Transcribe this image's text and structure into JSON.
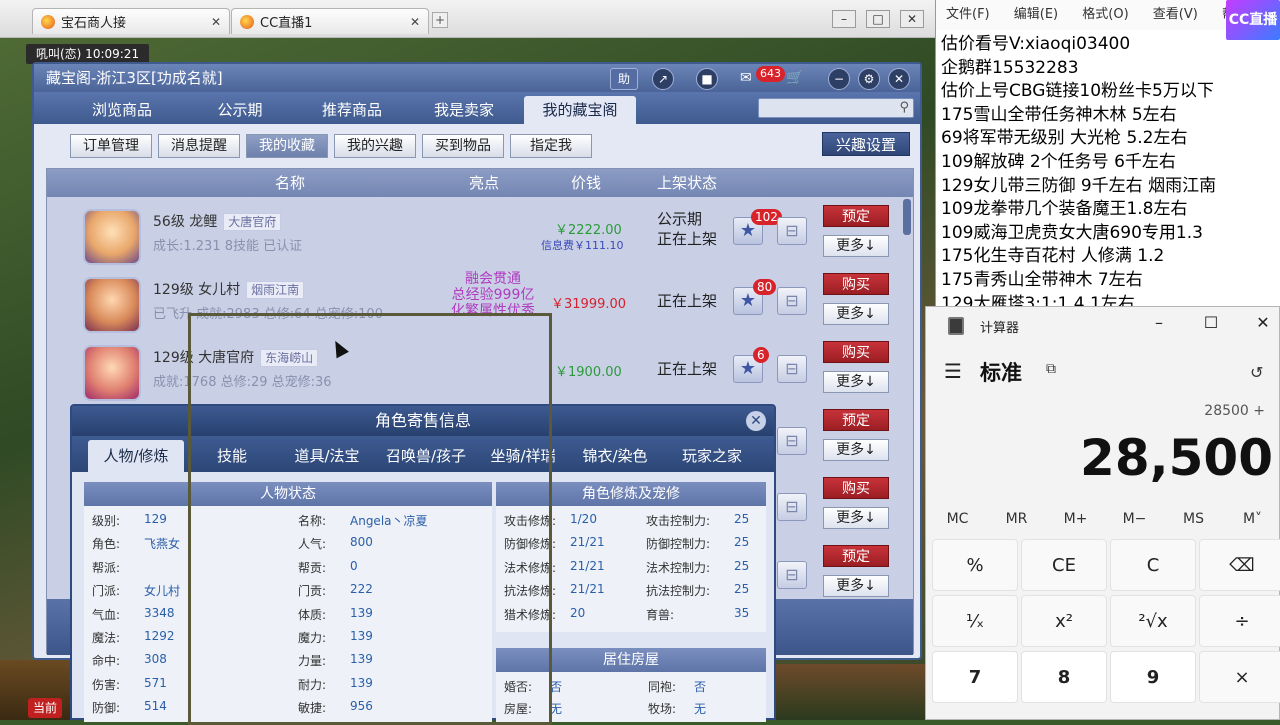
{
  "browser": {
    "tabs": [
      {
        "label": "宝石商人接",
        "close": "✕"
      },
      {
        "label": "CC直播1",
        "close": "✕"
      }
    ],
    "new_tab": "+",
    "clock": "吼叫(恋)  10:09:21"
  },
  "cbg": {
    "title": "藏宝阁-浙江3区[功成名就]",
    "title_icons": {
      "zhu": "助",
      "mail_count": "643"
    },
    "nav": [
      "浏览商品",
      "公示期",
      "推荐商品",
      "我是卖家",
      "我的藏宝阁"
    ],
    "nav_active": "我的藏宝阁",
    "subnav": [
      "订单管理",
      "消息提醒",
      "我的收藏",
      "我的兴趣",
      "买到物品",
      "指定我"
    ],
    "subnav_active": "我的收藏",
    "interest_btn": "兴趣设置",
    "table": {
      "headers": [
        "名称",
        "亮点",
        "价钱",
        "上架状态"
      ],
      "rows": [
        {
          "level_name": "56级 龙鲤",
          "tag": "大唐官府",
          "sub": "成长:1.231  8技能  已认证",
          "highlight": "",
          "price": "￥2222.00",
          "fee": "信息费￥111.10",
          "status": "公示期\n正在上架",
          "fav": "102",
          "action": "预定",
          "more": "更多↓"
        },
        {
          "level_name": "129级 女儿村",
          "tag": "烟雨江南",
          "sub": "已飞升  成就:2983  总修:64  总宠修:100",
          "highlight": "融会贯通\n总经验999亿\n化繁属性优秀",
          "price": "￥31999.00",
          "fee": "",
          "status": "正在上架",
          "fav": "80",
          "action": "购买",
          "more": "更多↓"
        },
        {
          "level_name": "129级 大唐官府",
          "tag": "东海崂山",
          "sub": "成就:1768  总修:29  总宠修:36",
          "highlight": "",
          "price": "￥1900.00",
          "fee": "",
          "status": "正在上架",
          "fav": "6",
          "action": "购买",
          "more": "更多↓"
        },
        {
          "action": "预定",
          "more": "更多↓"
        },
        {
          "action": "购买",
          "more": "更多↓"
        },
        {
          "action": "预定",
          "more": "更多↓"
        }
      ]
    }
  },
  "popup": {
    "title": "角色寄售信息",
    "tabs": [
      "人物/修炼",
      "技能",
      "道具/法宝",
      "召唤兽/孩子",
      "坐骑/祥瑞",
      "锦衣/染色",
      "玩家之家"
    ],
    "tab_active": "人物/修炼",
    "sec_status": "人物状态",
    "sec_cultivate": "角色修炼及宠修",
    "sec_house": "居住房屋",
    "status_left": [
      {
        "k": "级别:",
        "v": "129"
      },
      {
        "k": "角色:",
        "v": "飞燕女"
      },
      {
        "k": "帮派:",
        "v": ""
      },
      {
        "k": "门派:",
        "v": "女儿村"
      },
      {
        "k": "气血:",
        "v": "3348"
      },
      {
        "k": "魔法:",
        "v": "1292"
      },
      {
        "k": "命中:",
        "v": "308"
      },
      {
        "k": "伤害:",
        "v": "571"
      },
      {
        "k": "防御:",
        "v": "514"
      }
    ],
    "status_right": [
      {
        "k": "名称:",
        "v": "Angela丶凉夏"
      },
      {
        "k": "人气:",
        "v": "800"
      },
      {
        "k": "帮贡:",
        "v": "0"
      },
      {
        "k": "门贡:",
        "v": "222"
      },
      {
        "k": "体质:",
        "v": "139"
      },
      {
        "k": "魔力:",
        "v": "139"
      },
      {
        "k": "力量:",
        "v": "139"
      },
      {
        "k": "耐力:",
        "v": "139"
      },
      {
        "k": "敏捷:",
        "v": "956"
      }
    ],
    "cult_left": [
      {
        "k": "攻击修炼:",
        "v": "1/20"
      },
      {
        "k": "防御修炼:",
        "v": "21/21"
      },
      {
        "k": "法术修炼:",
        "v": "21/21"
      },
      {
        "k": "抗法修炼:",
        "v": "21/21"
      },
      {
        "k": "猎术修炼:",
        "v": "20"
      }
    ],
    "cult_right": [
      {
        "k": "攻击控制力:",
        "v": "25"
      },
      {
        "k": "防御控制力:",
        "v": "25"
      },
      {
        "k": "法术控制力:",
        "v": "25"
      },
      {
        "k": "抗法控制力:",
        "v": "25"
      },
      {
        "k": "育兽:",
        "v": "35"
      }
    ],
    "house": [
      {
        "k": "婚否:",
        "v": "否"
      },
      {
        "k": "同袍:",
        "v": "否"
      },
      {
        "k": "房屋:",
        "v": "无"
      },
      {
        "k": "牧场:",
        "v": "无"
      }
    ]
  },
  "bottom": {
    "dang": "当前"
  },
  "notepad": {
    "menu": [
      "文件(F)",
      "编辑(E)",
      "格式(O)",
      "查看(V)",
      "帮助"
    ],
    "lines": [
      "估价看号V:xiaoqi03400",
      "企鹅群15532283",
      "估价上号CBG链接10粉丝卡5万以下",
      "175雪山全带任务神木林 5左右",
      "69将军带无级别 大光枪 5.2左右",
      "109解放碑 2个任务号 6千左右",
      "129女儿带三防御 9千左右 烟雨江南",
      "109龙拳带几个装备魔王1.8左右",
      "109威海卫虎贲女大唐690专用1.3",
      "175化生寺百花村 人修满 1.2",
      "175青秀山全带神木  7左右",
      "129大雁塔3:1:1  4.1左右"
    ],
    "logo": "CC直播"
  },
  "calculator": {
    "title": "计算器",
    "mode": "标准",
    "expression": "28500 +",
    "display": "28,500",
    "memory": [
      "MC",
      "MR",
      "M+",
      "M−",
      "MS",
      "M˅"
    ],
    "keys": [
      [
        "%",
        "CE",
        "C",
        "⌫"
      ],
      [
        "¹⁄ₓ",
        "x²",
        "²√x",
        "÷"
      ],
      [
        "7",
        "8",
        "9",
        "×"
      ]
    ]
  }
}
